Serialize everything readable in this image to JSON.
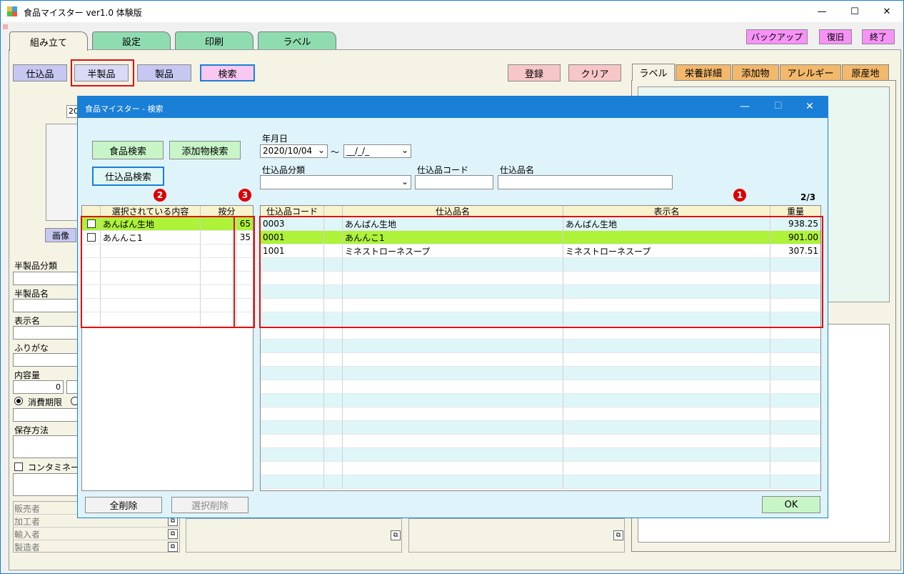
{
  "window": {
    "title": "食品マイスター ver1.0 体験版",
    "minimize": "—",
    "maximize": "☐",
    "close": "✕"
  },
  "main_tabs": [
    "組み立て",
    "設定",
    "印刷",
    "ラベル"
  ],
  "top_right_buttons": {
    "backup": "バックアップ",
    "restore": "復旧",
    "exit": "終了"
  },
  "toolbar": {
    "shikomi": "仕込品",
    "hanseihin": "半製品",
    "seihin": "製品",
    "search": "検索",
    "register": "登録",
    "clear": "クリア"
  },
  "right_tabs": [
    "ラベル",
    "栄養詳細",
    "添加物",
    "アレルギー",
    "原産地"
  ],
  "left_form": {
    "date_prefix": "20",
    "image_label": "画像",
    "hanseihin_category": "半製品分類",
    "hanseihin_name": "半製品名",
    "display_name": "表示名",
    "furigana": "ふりがな",
    "content_amount": "内容量",
    "content_value": "0",
    "expiry_label": "消費期限",
    "storage": "保存方法",
    "contamination": "コンタミネーシ",
    "seller": "販売者",
    "processor": "加工者",
    "importer": "輸入者",
    "manufacturer": "製造者"
  },
  "dialog": {
    "title": "食品マイスター - 検索",
    "food_search": "食品検索",
    "additive_search": "添加物検索",
    "shikomi_search": "仕込品検索",
    "date_label": "年月日",
    "date_from": "2020/10/04",
    "tilde": "〜",
    "date_to": "__/_/_",
    "category_label": "仕込品分類",
    "code_label": "仕込品コード",
    "name_label": "仕込品名",
    "page": "2/3",
    "marker1": "1",
    "marker2": "2",
    "marker3": "3",
    "left_grid": {
      "headers": [
        "選択されている内容",
        "按分"
      ],
      "rows": [
        {
          "name": "あんぱん生地",
          "ratio": "65"
        },
        {
          "name": "あんんこ1",
          "ratio": "35"
        }
      ]
    },
    "right_grid": {
      "headers": [
        "仕込品コード",
        "仕込品名",
        "表示名",
        "重量"
      ],
      "rows": [
        {
          "code": "0003",
          "name": "あんぱん生地",
          "display": "あんぱん生地",
          "weight": "938.25"
        },
        {
          "code": "0001",
          "name": "あんんこ1",
          "display": "",
          "weight": "901.00"
        },
        {
          "code": "1001",
          "name": "ミネストローネスープ",
          "display": "ミネストローネスープ",
          "weight": "307.51"
        }
      ]
    },
    "delete_all": "全削除",
    "delete_selected": "選択削除",
    "ok": "OK"
  }
}
